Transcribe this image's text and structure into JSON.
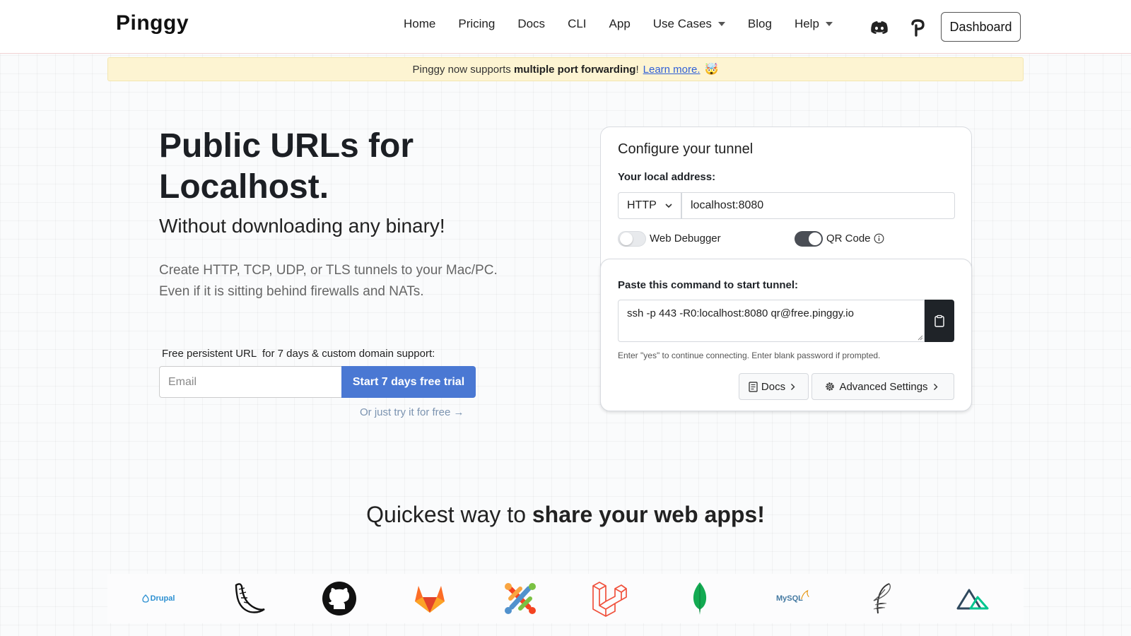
{
  "brand": {
    "name": "Pinggy"
  },
  "nav": {
    "links": [
      {
        "label": "Home",
        "dropdown": false
      },
      {
        "label": "Pricing",
        "dropdown": false
      },
      {
        "label": "Docs",
        "dropdown": false
      },
      {
        "label": "CLI",
        "dropdown": false
      },
      {
        "label": "App",
        "dropdown": false
      },
      {
        "label": "Use Cases",
        "dropdown": true
      },
      {
        "label": "Blog",
        "dropdown": false
      },
      {
        "label": "Help",
        "dropdown": true
      }
    ],
    "icons": [
      "discord-icon",
      "pinggy-p-icon"
    ],
    "dashboard_label": "Dashboard"
  },
  "banner": {
    "prefix": "Pinggy now supports",
    "highlight": "multiple port forwarding",
    "suffix": "!",
    "link": "Learn more.",
    "emoji": "🤯"
  },
  "hero": {
    "title_line1": "Public URLs for",
    "title_line2": "Localhost.",
    "subtitle": "Without downloading any binary!",
    "desc_line1": "Create HTTP, TCP, UDP, or TLS tunnels to your Mac/PC.",
    "desc_line2": "Even if it is sitting behind firewalls and NATs.",
    "trial_label": "Free persistent URL  for 7 days & custom domain support:",
    "email_placeholder": "Email",
    "trial_button": "Start 7 days free trial",
    "free_link": "Or just try it for free →"
  },
  "config": {
    "title": "Configure your tunnel",
    "address_label": "Your local address:",
    "protocol": "HTTP",
    "address_value": "localhost:8080",
    "web_debugger": {
      "label": "Web Debugger",
      "on": false
    },
    "qr_code": {
      "label": "QR Code",
      "on": true
    },
    "command_label": "Paste this command to start tunnel:",
    "command": "ssh -p 443 -R0:localhost:8080 qr@free.pinggy.io",
    "hint": "Enter \"yes\" to continue connecting. Enter blank password if prompted.",
    "docs_button": "Docs",
    "advanced_button": "Advanced Settings"
  },
  "share": {
    "prefix": "Quickest way to",
    "highlight": "share your web apps",
    "suffix": "!"
  },
  "tech_logos": [
    {
      "name": "drupal-logo",
      "text": "Drupal"
    },
    {
      "name": "flask-logo",
      "text": ""
    },
    {
      "name": "github-logo",
      "text": ""
    },
    {
      "name": "gitlab-logo",
      "text": ""
    },
    {
      "name": "joomla-logo",
      "text": ""
    },
    {
      "name": "laravel-logo",
      "text": ""
    },
    {
      "name": "mongodb-logo",
      "text": ""
    },
    {
      "name": "mysql-logo",
      "text": "MySQL"
    },
    {
      "name": "sqlite-logo",
      "text": ""
    },
    {
      "name": "nuxt-logo",
      "text": ""
    }
  ],
  "colors": {
    "accent_button": "#4a78d3",
    "banner_bg": "#fdf4d2",
    "link": "#2f5fd6",
    "copy_button": "#1f2328"
  }
}
